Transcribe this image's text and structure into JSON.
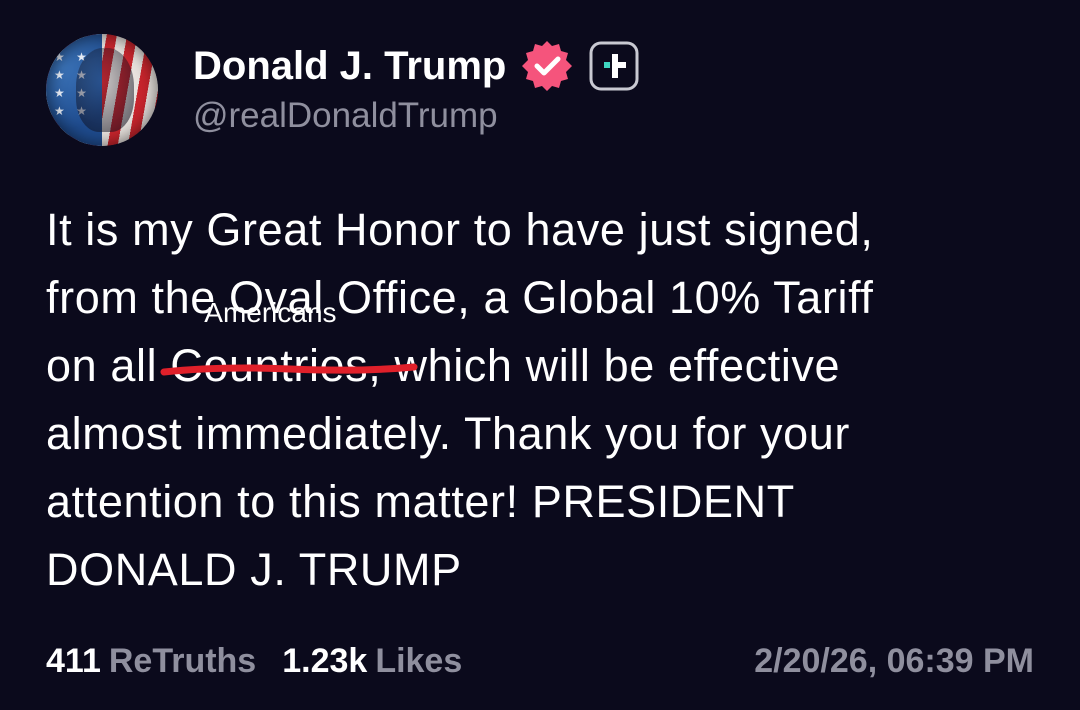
{
  "author": {
    "name": "Donald J. Trump",
    "handle": "@realDonaldTrump",
    "verified_color": "#f5547c"
  },
  "post": {
    "line1": "It is my Great Honor to have just signed,",
    "line2": "from the Oval Office, a Global 10% Tariff",
    "line3_pre": "on all ",
    "struck_word": "Countries,",
    "inserted_word": "Americans",
    "line3_post": " which will be effective",
    "line4": "almost immediately. Thank you for your",
    "line5": "attention to this matter! PRESIDENT",
    "line6": "DONALD J. TRUMP",
    "strike_color": "#e0202a"
  },
  "stats": {
    "retruths_count": "411",
    "retruths_label": "ReTruths",
    "likes_count": "1.23k",
    "likes_label": "Likes"
  },
  "timestamp": "2/20/26, 06:39 PM"
}
